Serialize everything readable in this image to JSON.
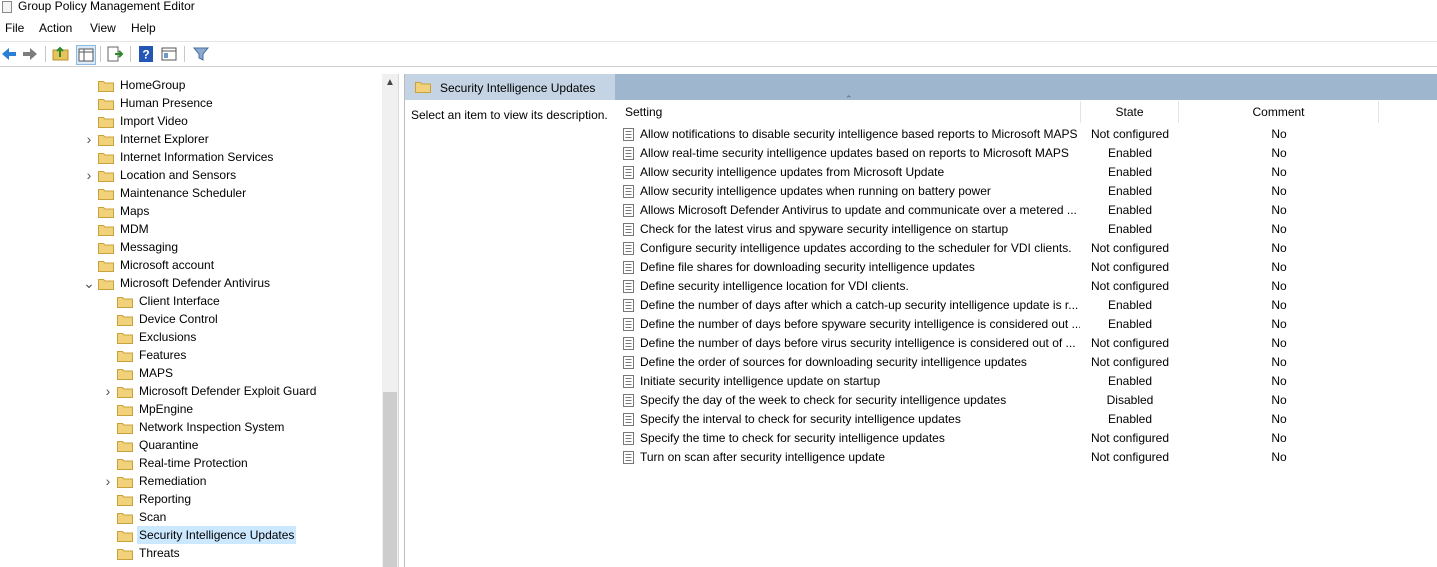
{
  "window": {
    "title": "Group Policy Management Editor"
  },
  "menu": [
    {
      "label": "File"
    },
    {
      "label": "Action"
    },
    {
      "label": "View"
    },
    {
      "label": "Help"
    }
  ],
  "toolbar": [
    "back-icon",
    "forward-icon",
    "up-folder-icon",
    "show-hide-tree-icon",
    "export-list-icon",
    "help-icon",
    "properties-icon",
    "filter-icon"
  ],
  "tree": [
    {
      "label": "HomeGroup",
      "indent": 0,
      "expander": ""
    },
    {
      "label": "Human Presence",
      "indent": 0,
      "expander": ""
    },
    {
      "label": "Import Video",
      "indent": 0,
      "expander": ""
    },
    {
      "label": "Internet Explorer",
      "indent": 0,
      "expander": ">"
    },
    {
      "label": "Internet Information Services",
      "indent": 0,
      "expander": ""
    },
    {
      "label": "Location and Sensors",
      "indent": 0,
      "expander": ">"
    },
    {
      "label": "Maintenance Scheduler",
      "indent": 0,
      "expander": ""
    },
    {
      "label": "Maps",
      "indent": 0,
      "expander": ""
    },
    {
      "label": "MDM",
      "indent": 0,
      "expander": ""
    },
    {
      "label": "Messaging",
      "indent": 0,
      "expander": ""
    },
    {
      "label": "Microsoft account",
      "indent": 0,
      "expander": ""
    },
    {
      "label": "Microsoft Defender Antivirus",
      "indent": 0,
      "expander": "v"
    },
    {
      "label": "Client Interface",
      "indent": 1,
      "expander": ""
    },
    {
      "label": "Device Control",
      "indent": 1,
      "expander": ""
    },
    {
      "label": "Exclusions",
      "indent": 1,
      "expander": ""
    },
    {
      "label": "Features",
      "indent": 1,
      "expander": ""
    },
    {
      "label": "MAPS",
      "indent": 1,
      "expander": ""
    },
    {
      "label": "Microsoft Defender Exploit Guard",
      "indent": 1,
      "expander": ">"
    },
    {
      "label": "MpEngine",
      "indent": 1,
      "expander": ""
    },
    {
      "label": "Network Inspection System",
      "indent": 1,
      "expander": ""
    },
    {
      "label": "Quarantine",
      "indent": 1,
      "expander": ""
    },
    {
      "label": "Real-time Protection",
      "indent": 1,
      "expander": ""
    },
    {
      "label": "Remediation",
      "indent": 1,
      "expander": ">"
    },
    {
      "label": "Reporting",
      "indent": 1,
      "expander": ""
    },
    {
      "label": "Scan",
      "indent": 1,
      "expander": ""
    },
    {
      "label": "Security Intelligence Updates",
      "indent": 1,
      "expander": "",
      "selected": true
    },
    {
      "label": "Threats",
      "indent": 1,
      "expander": ""
    }
  ],
  "right": {
    "header_title": "Security Intelligence Updates",
    "description": "Select an item to view its description.",
    "columns": {
      "setting": "Setting",
      "state": "State",
      "comment": "Comment"
    },
    "rows": [
      {
        "setting": "Allow notifications to disable security intelligence based reports to Microsoft MAPS",
        "state": "Not configured",
        "comment": "No"
      },
      {
        "setting": "Allow real-time security intelligence updates based on reports to Microsoft MAPS",
        "state": "Enabled",
        "comment": "No"
      },
      {
        "setting": "Allow security intelligence updates from Microsoft Update",
        "state": "Enabled",
        "comment": "No"
      },
      {
        "setting": "Allow security intelligence updates when running on battery power",
        "state": "Enabled",
        "comment": "No"
      },
      {
        "setting": "Allows Microsoft Defender Antivirus to update and communicate over a metered ...",
        "state": "Enabled",
        "comment": "No"
      },
      {
        "setting": "Check for the latest virus and spyware security intelligence on startup",
        "state": "Enabled",
        "comment": "No"
      },
      {
        "setting": "Configure security intelligence updates according to the scheduler for VDI clients.",
        "state": "Not configured",
        "comment": "No"
      },
      {
        "setting": "Define file shares for downloading security intelligence updates",
        "state": "Not configured",
        "comment": "No"
      },
      {
        "setting": "Define security intelligence location for VDI clients.",
        "state": "Not configured",
        "comment": "No"
      },
      {
        "setting": "Define the number of days after which a catch-up security intelligence update is r...",
        "state": "Enabled",
        "comment": "No"
      },
      {
        "setting": "Define the number of days before spyware security intelligence is considered out ...",
        "state": "Enabled",
        "comment": "No"
      },
      {
        "setting": "Define the number of days before virus security intelligence is considered out of ...",
        "state": "Not configured",
        "comment": "No"
      },
      {
        "setting": "Define the order of sources for downloading security intelligence updates",
        "state": "Not configured",
        "comment": "No"
      },
      {
        "setting": "Initiate security intelligence update on startup",
        "state": "Enabled",
        "comment": "No"
      },
      {
        "setting": "Specify the day of the week to check for security intelligence updates",
        "state": "Disabled",
        "comment": "No"
      },
      {
        "setting": "Specify the interval to check for security intelligence updates",
        "state": "Enabled",
        "comment": "No"
      },
      {
        "setting": "Specify the time to check for security intelligence updates",
        "state": "Not configured",
        "comment": "No"
      },
      {
        "setting": "Turn on scan after security intelligence update",
        "state": "Not configured",
        "comment": "No"
      }
    ]
  },
  "colors": {
    "header_band": "#9fb6cf",
    "selection": "#cce8ff",
    "folder": "#e8c25a"
  }
}
